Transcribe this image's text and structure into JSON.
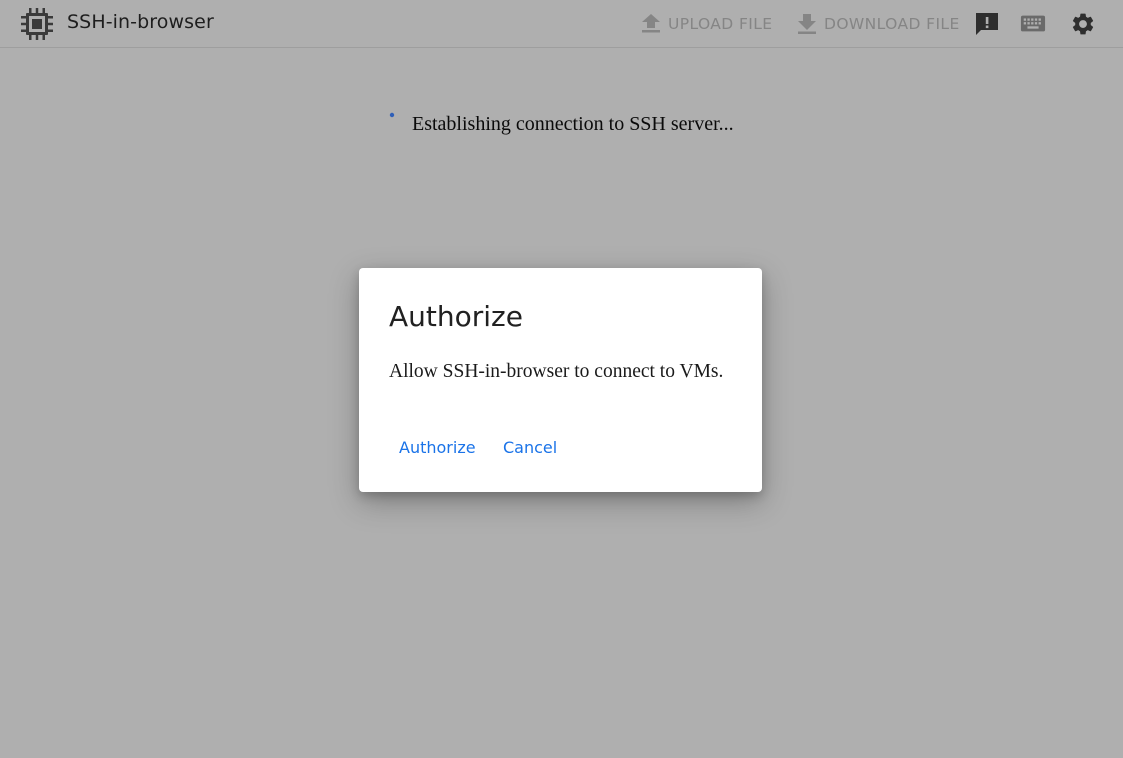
{
  "header": {
    "app_icon": "chip-icon",
    "title": "SSH-in-browser",
    "upload_label": "UPLOAD FILE",
    "download_label": "DOWNLOAD FILE",
    "feedback_icon": "feedback-icon",
    "keyboard_icon": "keyboard-icon",
    "settings_icon": "gear-icon"
  },
  "status": {
    "text": "Establishing connection to SSH server...",
    "spinner_color": "#1a73e8"
  },
  "dialog": {
    "title": "Authorize",
    "body": "Allow SSH-in-browser to connect to VMs.",
    "authorize_label": "Authorize",
    "cancel_label": "Cancel",
    "button_color": "#1a73e8"
  },
  "colors": {
    "overlay_bg": "#afafaf",
    "dialog_bg": "#ffffff"
  }
}
